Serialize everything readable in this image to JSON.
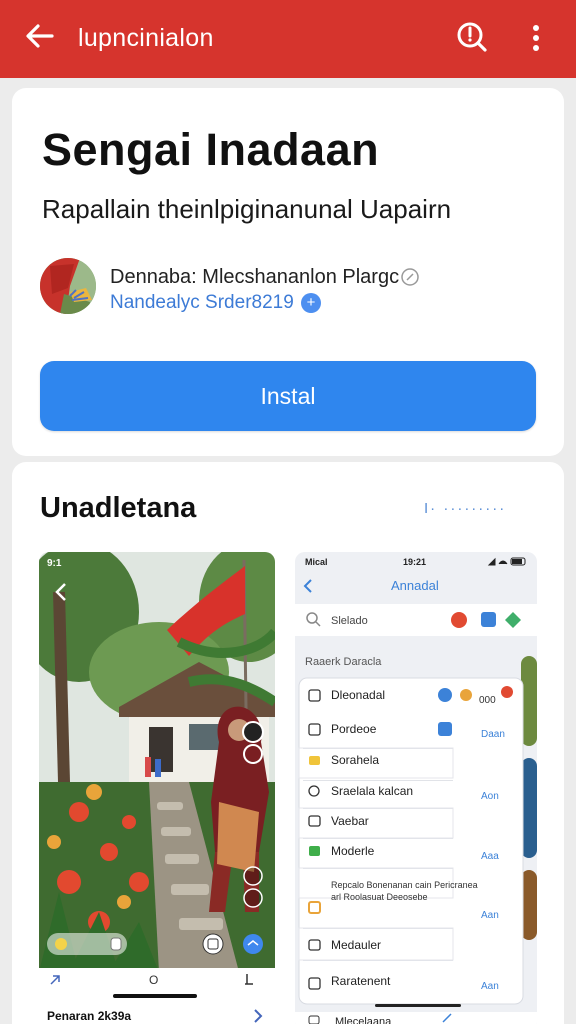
{
  "appbar": {
    "title": "lupncinialon",
    "bg_color": "#d6342d",
    "back_icon": "arrow-left-icon",
    "search_icon": "search-icon",
    "more_icon": "more-vertical-icon"
  },
  "app": {
    "title": "Sengai Inadaan",
    "subtitle": "Rapallain theinlpiginanunal Uapairn",
    "developer_name": "Dennaba: Mlecshananlon Plargc",
    "developer_meta": "Nandealyc Srder8219",
    "install_label": "Instal",
    "install_color": "#2f86ee"
  },
  "screenshots_section": {
    "title": "Unadletana",
    "more_label": "I· ·········",
    "shot1": {
      "status_time": "9:1",
      "caption": "Penaran 2k39a",
      "bottom_center": "O"
    },
    "shot2": {
      "status_left": "Mical",
      "status_time": "19:21",
      "header_title": "Annadal",
      "search_text": "Slelado",
      "section_label": "Raaerk Daracla",
      "menu": [
        {
          "label": "Dleonadal",
          "icon": "grid-icon",
          "badge": "000"
        },
        {
          "label": "Pordeoe",
          "icon": "calendar-icon",
          "badge": "Daan"
        },
        {
          "label": "Sorahela",
          "icon": "folder-icon",
          "badge": ""
        },
        {
          "label": "Sraelala kalcan",
          "icon": "cloud-icon",
          "badge": "Aon"
        },
        {
          "label": "Vaebar",
          "icon": "chat-icon",
          "badge": ""
        },
        {
          "label": "Moderle",
          "icon": "image-icon",
          "badge": "Aaa"
        },
        {
          "label": "Repcalo Bonenanan cain Pericranea arl Roolasuat Deeosebe",
          "icon": "lock-icon",
          "badge": "Aan"
        },
        {
          "label": "Medauler",
          "icon": "media-icon",
          "badge": ""
        },
        {
          "label": "Raratenent",
          "icon": "puzzle-icon",
          "badge": "Aan"
        }
      ],
      "bottom_label": "Mlecelaana"
    }
  }
}
